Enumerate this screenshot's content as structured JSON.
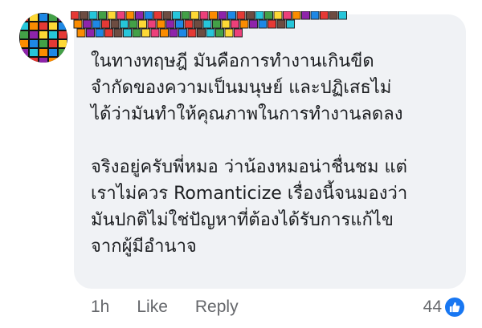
{
  "comment": {
    "paragraphs": [
      {
        "lines": [
          "ในทางทฤษฎี  มันคือการทำงานเกินขีด",
          "จำกัดของความเป็นมนุษย์  และปฏิเสธไม่",
          "ได้ว่ามันทำให้คุณภาพในการทำงานลดลง"
        ]
      },
      {
        "lines": [
          "จริงอยู่ครับพี่หมอ ว่าน้องหมอน่าชื่นชม  แต่",
          "เราไม่ควร Romanticize เรื่องนี้จนมองว่า",
          "มันปกติไม่ใช่ปัญหาที่ต้องได้รับการแก้ไข",
          "จากผู้มีอำนาจ"
        ]
      }
    ]
  },
  "meta": {
    "timestamp": "1h",
    "like_label": "Like",
    "reply_label": "Reply"
  },
  "reactions": {
    "count": "44",
    "icon": "thumbs-up-icon",
    "badge_color": "#1877f2"
  }
}
